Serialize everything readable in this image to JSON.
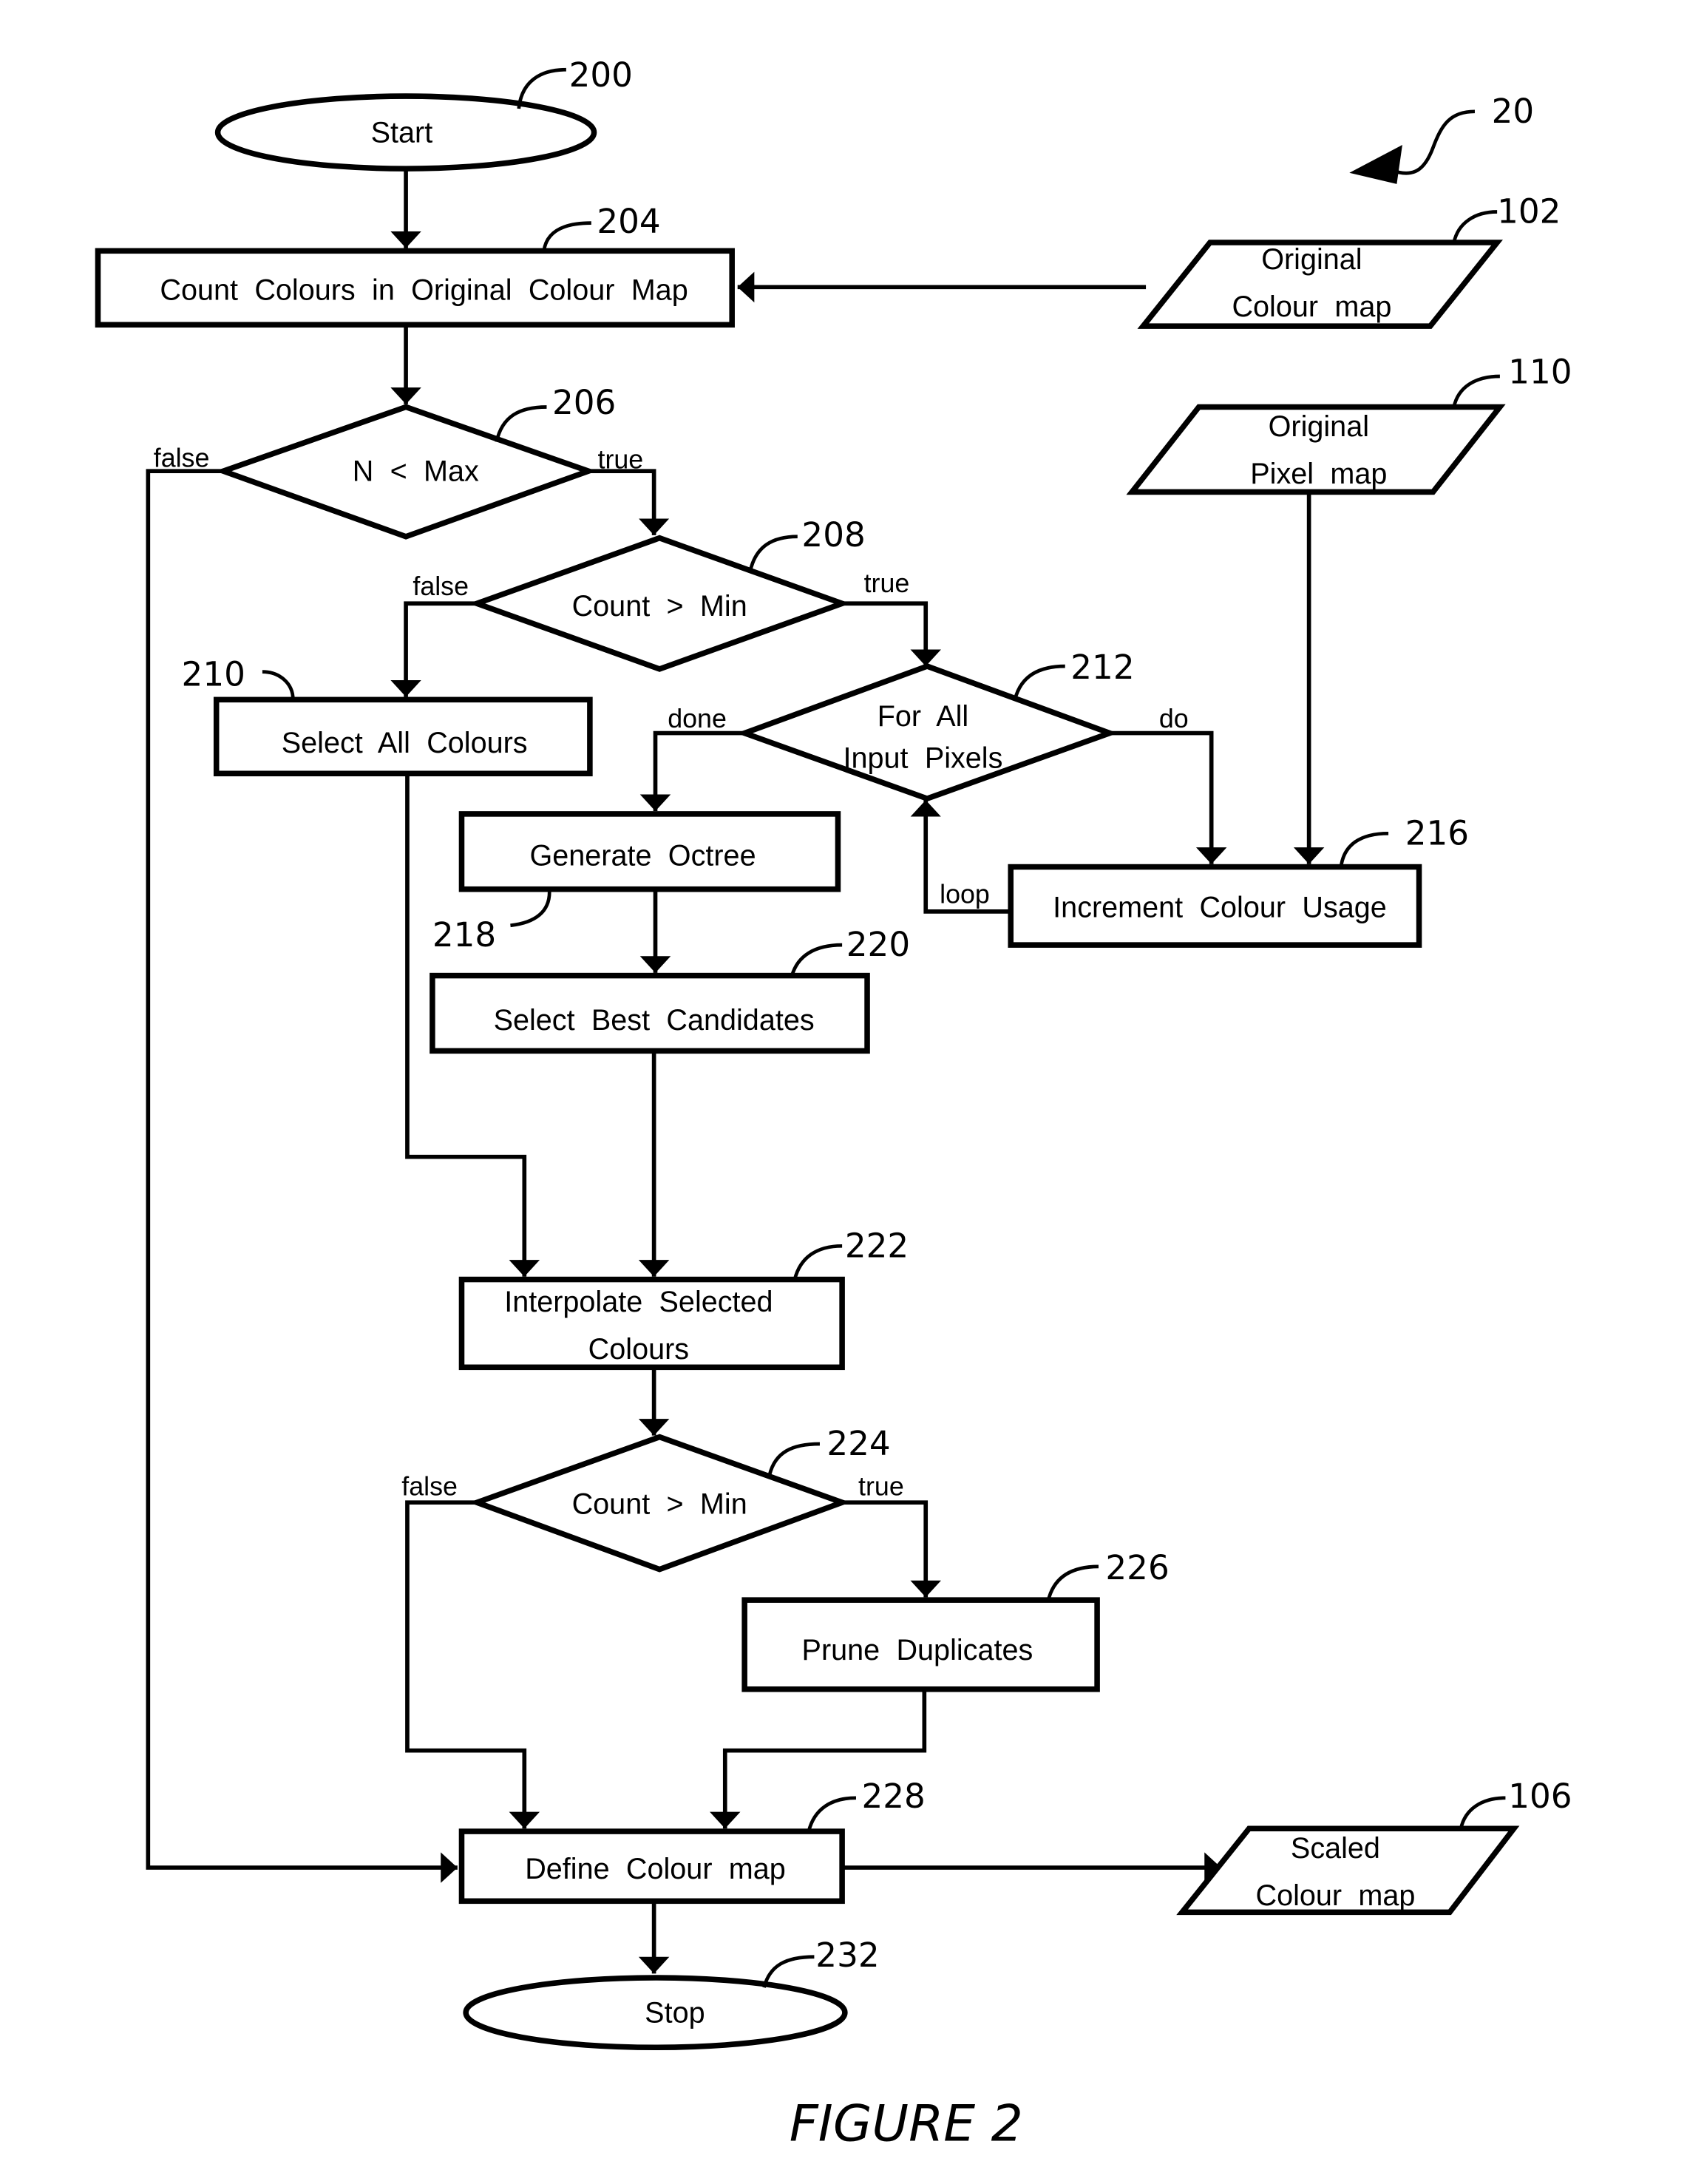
{
  "figure": {
    "caption": "FIGURE 2",
    "figure_ref": "20"
  },
  "nodes": {
    "start": {
      "ref": "200",
      "type": "terminal",
      "lines": [
        "Start"
      ]
    },
    "count_colours": {
      "ref": "204",
      "type": "process",
      "lines": [
        "Count  Colours  in  Original  Colour  Map"
      ]
    },
    "n_lt_max": {
      "ref": "206",
      "type": "decision",
      "lines": [
        "N  <  Max"
      ]
    },
    "count_gt_min_1": {
      "ref": "208",
      "type": "decision",
      "lines": [
        "Count  >  Min"
      ]
    },
    "select_all": {
      "ref": "210",
      "type": "process",
      "lines": [
        "Select  All  Colours"
      ]
    },
    "for_all_pixels": {
      "ref": "212",
      "type": "decision",
      "lines": [
        "For  All",
        "Input  Pixels"
      ]
    },
    "increment_usage": {
      "ref": "216",
      "type": "process",
      "lines": [
        "Increment  Colour  Usage"
      ]
    },
    "generate_octree": {
      "ref": "218",
      "type": "process",
      "lines": [
        "Generate  Octree"
      ]
    },
    "select_best": {
      "ref": "220",
      "type": "process",
      "lines": [
        "Select  Best  Candidates"
      ]
    },
    "interpolate": {
      "ref": "222",
      "type": "process",
      "lines": [
        "Interpolate  Selected",
        "Colours"
      ]
    },
    "count_gt_min_2": {
      "ref": "224",
      "type": "decision",
      "lines": [
        "Count  >  Min"
      ]
    },
    "prune": {
      "ref": "226",
      "type": "process",
      "lines": [
        "Prune  Duplicates"
      ]
    },
    "define_map": {
      "ref": "228",
      "type": "process",
      "lines": [
        "Define  Colour  map"
      ]
    },
    "stop": {
      "ref": "232",
      "type": "terminal",
      "lines": [
        "Stop"
      ]
    },
    "orig_colour_map": {
      "ref": "102",
      "type": "data",
      "lines": [
        "Original",
        "Colour  map"
      ]
    },
    "orig_pixel_map": {
      "ref": "110",
      "type": "data",
      "lines": [
        "Original",
        "Pixel  map"
      ]
    },
    "scaled_colour_map": {
      "ref": "106",
      "type": "data",
      "lines": [
        "Scaled",
        "Colour  map"
      ]
    }
  },
  "edge_labels": {
    "n_lt_max_false": "false",
    "n_lt_max_true": "true",
    "count1_false": "false",
    "count1_true": "true",
    "for_all_done": "done",
    "for_all_do": "do",
    "loop": "loop",
    "count2_false": "false",
    "count2_true": "true"
  }
}
